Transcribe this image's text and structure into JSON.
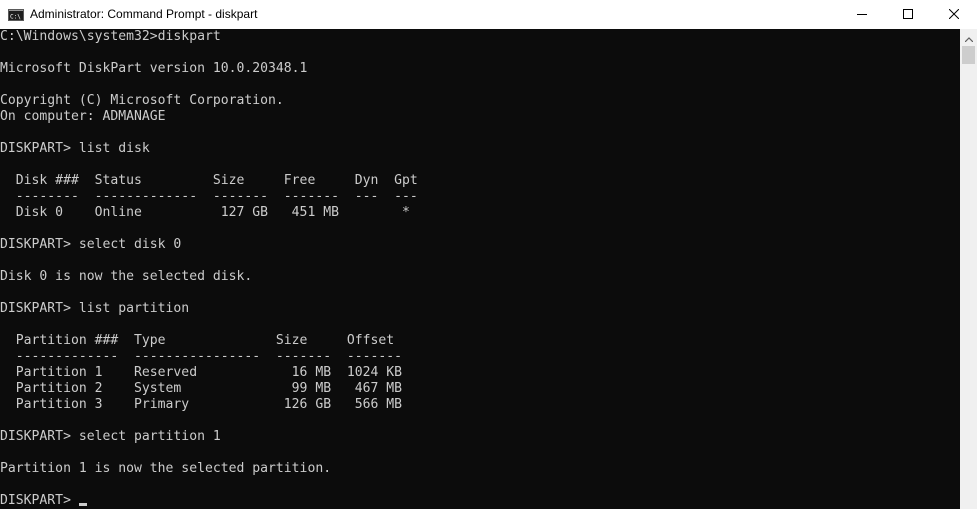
{
  "window": {
    "title": "Administrator: Command Prompt - diskpart"
  },
  "icons": {
    "app": "cmd-icon",
    "minimize": "minimize-icon",
    "maximize": "maximize-icon",
    "close": "close-icon",
    "scroll_up": "scroll-up-arrow-icon"
  },
  "console": {
    "lines": [
      "C:\\Windows\\system32>diskpart",
      "",
      "Microsoft DiskPart version 10.0.20348.1",
      "",
      "Copyright (C) Microsoft Corporation.",
      "On computer: ADMANAGE",
      "",
      "DISKPART> list disk",
      "",
      "  Disk ###  Status         Size     Free     Dyn  Gpt",
      "  --------  -------------  -------  -------  ---  ---",
      "  Disk 0    Online          127 GB   451 MB        *",
      "",
      "DISKPART> select disk 0",
      "",
      "Disk 0 is now the selected disk.",
      "",
      "DISKPART> list partition",
      "",
      "  Partition ###  Type              Size     Offset",
      "  -------------  ----------------  -------  -------",
      "  Partition 1    Reserved            16 MB  1024 KB",
      "  Partition 2    System              99 MB   467 MB",
      "  Partition 3    Primary            126 GB   566 MB",
      "",
      "DISKPART> select partition 1",
      "",
      "Partition 1 is now the selected partition.",
      ""
    ],
    "prompt": "DISKPART> "
  },
  "colors": {
    "console_bg": "#0c0c0c",
    "console_fg": "#cccccc",
    "titlebar_bg": "#ffffff"
  }
}
